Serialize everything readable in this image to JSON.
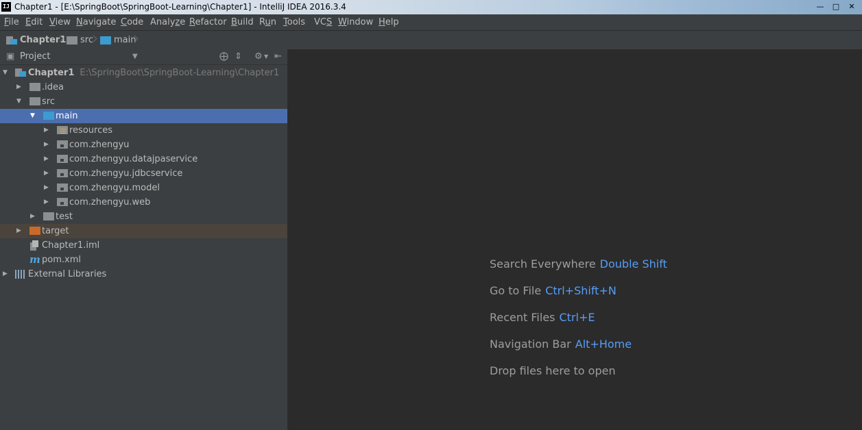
{
  "window": {
    "title": "Chapter1 - [E:\\SpringBoot\\SpringBoot-Learning\\Chapter1] - IntelliJ IDEA 2016.3.4",
    "logo_text": "IJ"
  },
  "menu": {
    "items": [
      {
        "mn": "F",
        "rest": "ile"
      },
      {
        "mn": "E",
        "rest": "dit"
      },
      {
        "mn": "V",
        "rest": "iew"
      },
      {
        "mn": "N",
        "rest": "avigate"
      },
      {
        "mn": "C",
        "rest": "ode"
      },
      {
        "pre": "Analy",
        "mn": "z",
        "rest": "e"
      },
      {
        "mn": "R",
        "rest": "efactor"
      },
      {
        "mn": "B",
        "rest": "uild"
      },
      {
        "pre": "R",
        "mn": "u",
        "rest": "n"
      },
      {
        "mn": "T",
        "rest": "ools"
      },
      {
        "pre": "VC",
        "mn": "S",
        "rest": ""
      },
      {
        "mn": "W",
        "rest": "indow"
      },
      {
        "mn": "H",
        "rest": "elp"
      }
    ]
  },
  "breadcrumb": {
    "items": [
      "Chapter1",
      "src",
      "main"
    ]
  },
  "project_panel": {
    "title": "Project",
    "tree": [
      {
        "label": "Chapter1",
        "path": "E:\\SpringBoot\\SpringBoot-Learning\\Chapter1"
      },
      {
        "label": ".idea"
      },
      {
        "label": "src"
      },
      {
        "label": "main"
      },
      {
        "label": "resources"
      },
      {
        "label": "com.zhengyu"
      },
      {
        "label": "com.zhengyu.datajpaservice"
      },
      {
        "label": "com.zhengyu.jdbcservice"
      },
      {
        "label": "com.zhengyu.model"
      },
      {
        "label": "com.zhengyu.web"
      },
      {
        "label": "test"
      },
      {
        "label": "target"
      },
      {
        "label": "Chapter1.iml"
      },
      {
        "label": "pom.xml"
      },
      {
        "label": "External Libraries"
      }
    ]
  },
  "editor": {
    "hints": [
      {
        "text": "Search Everywhere",
        "key": "Double Shift"
      },
      {
        "text": "Go to File",
        "key": "Ctrl+Shift+N"
      },
      {
        "text": "Recent Files",
        "key": "Ctrl+E"
      },
      {
        "text": "Navigation Bar",
        "key": "Alt+Home"
      },
      {
        "text": "Drop files here to open",
        "key": ""
      }
    ]
  },
  "colors": {
    "selection": "#4b6eaf",
    "editor_bg": "#2b2b2b",
    "panel_bg": "#3c3f41",
    "shortcut_blue": "#589df6",
    "source_folder": "#3d9bd0",
    "excluded_folder": "#c76a2c"
  }
}
